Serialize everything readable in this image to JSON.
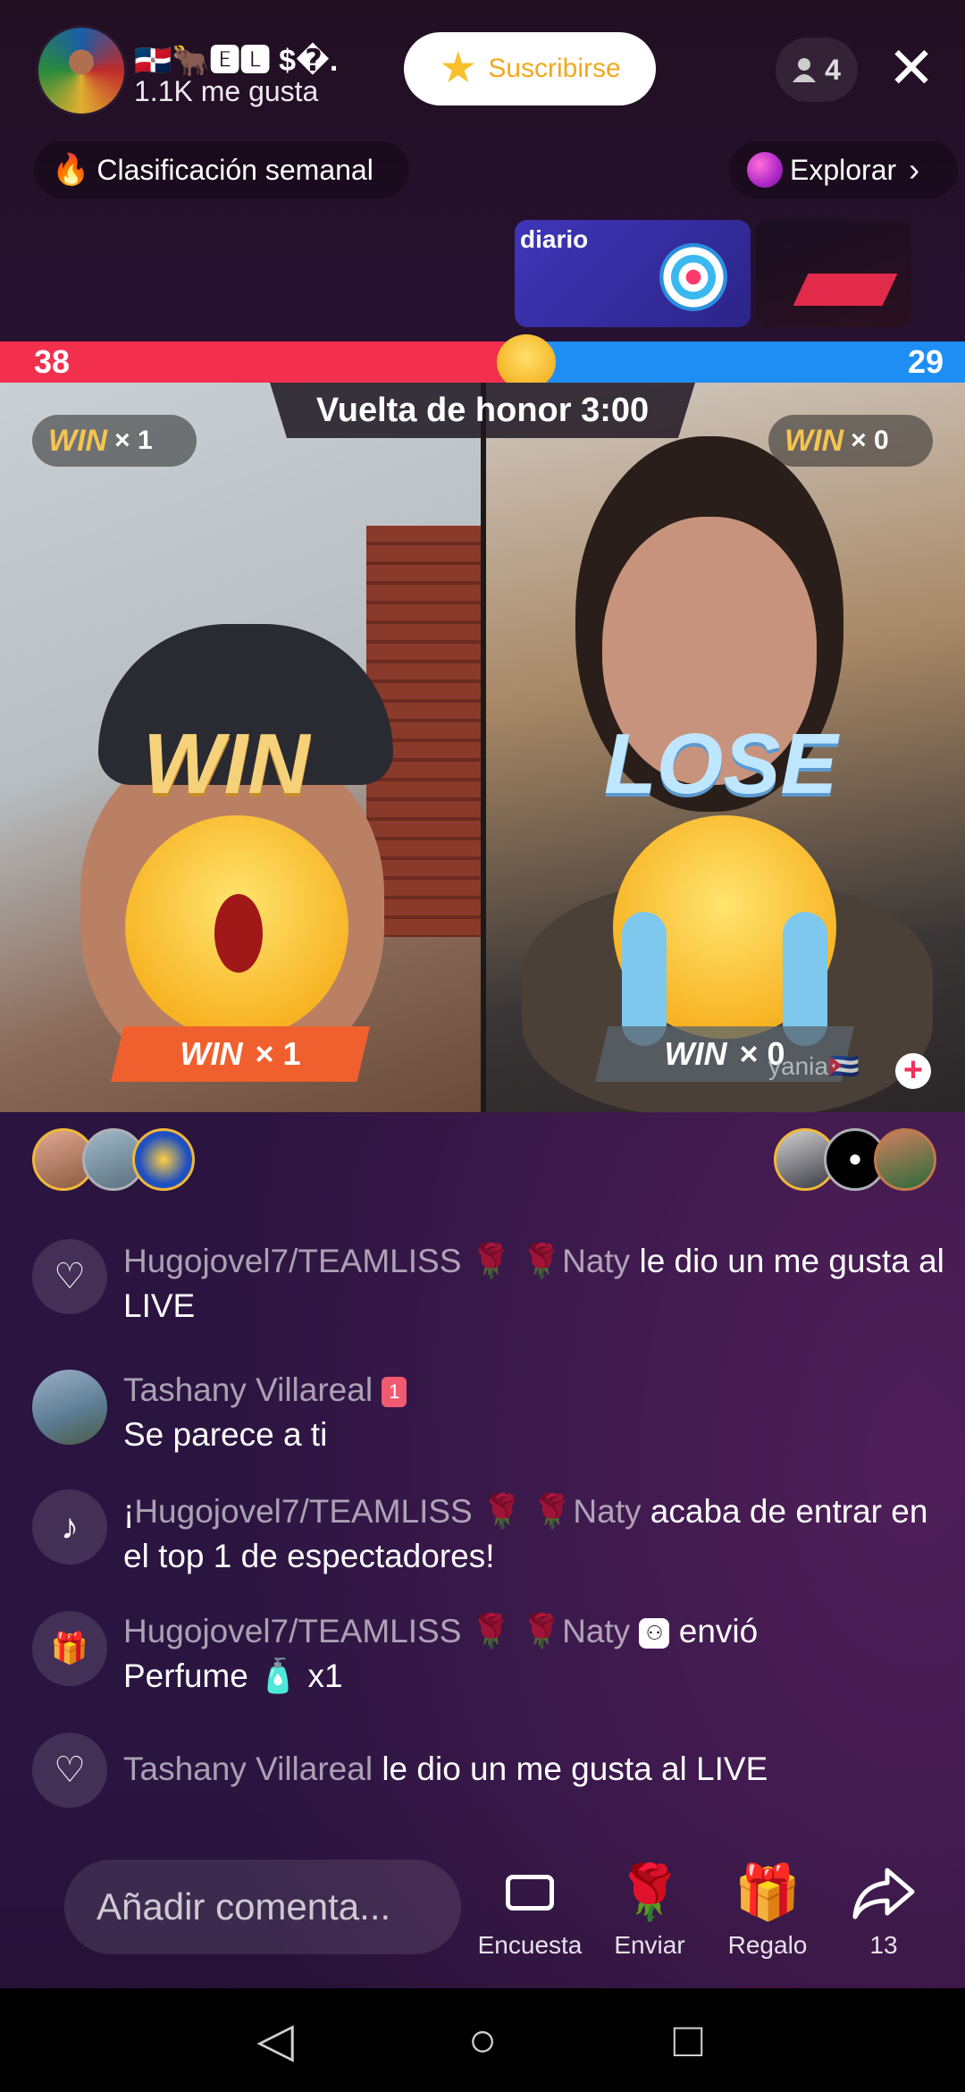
{
  "header": {
    "host_name": "🇩🇴🐂🅴🅻 $�.",
    "likes": "1.1K me gusta",
    "subscribe_label": "Suscribirse",
    "viewer_count": "4"
  },
  "pills": {
    "ranking": "Clasificación semanal",
    "explore": "Explorar"
  },
  "promo": {
    "banner_label": "diario"
  },
  "battle": {
    "score_left": "38",
    "score_right": "29",
    "timer": "Vuelta de honor 3:00",
    "win_word": "WIN",
    "left_wins": "× 1",
    "right_wins": "× 0",
    "result_left": "WIN",
    "result_right": "LOSE",
    "bottom_left_count": "× 1",
    "bottom_right_count": "× 0",
    "guest_name": "yania🇨🇺"
  },
  "chat": [
    {
      "type": "like",
      "name": "Hugojovel7/TEAMLISS 🌹 🌹Naty",
      "text": "le dio un me gusta al LIVE"
    },
    {
      "type": "comment",
      "name": "Tashany Villareal",
      "badge": "1",
      "text": "Se parece a ti"
    },
    {
      "type": "system",
      "prefix": "¡",
      "name": "Hugojovel7/TEAMLISS 🌹 🌹Naty",
      "text": "acaba de entrar en el top 1 de espectadores!"
    },
    {
      "type": "gift",
      "name": "Hugojovel7/TEAMLISS 🌹 🌹Naty",
      "text": "envió",
      "gift": "Perfume",
      "qty": "x1"
    },
    {
      "type": "like",
      "name": "Tashany Villareal",
      "text": "le dio un me gusta al LIVE"
    }
  ],
  "bottom": {
    "comment_placeholder": "Añadir comenta...",
    "poll_label": "Encuesta",
    "send_label": "Enviar",
    "gift_label": "Regalo",
    "share_count": "13"
  },
  "icons": [
    "close-icon",
    "person-icon",
    "star-icon",
    "flame-icon",
    "planet-icon",
    "heart-icon",
    "tiktok-icon",
    "gift-icon",
    "rose-icon",
    "share-icon",
    "back-icon",
    "home-icon",
    "recents-icon"
  ],
  "colors": {
    "red_team": "#f2304e",
    "blue_team": "#1e8ef5",
    "subscribe_text": "#f3a81e",
    "win_gold": "#f5c450"
  }
}
